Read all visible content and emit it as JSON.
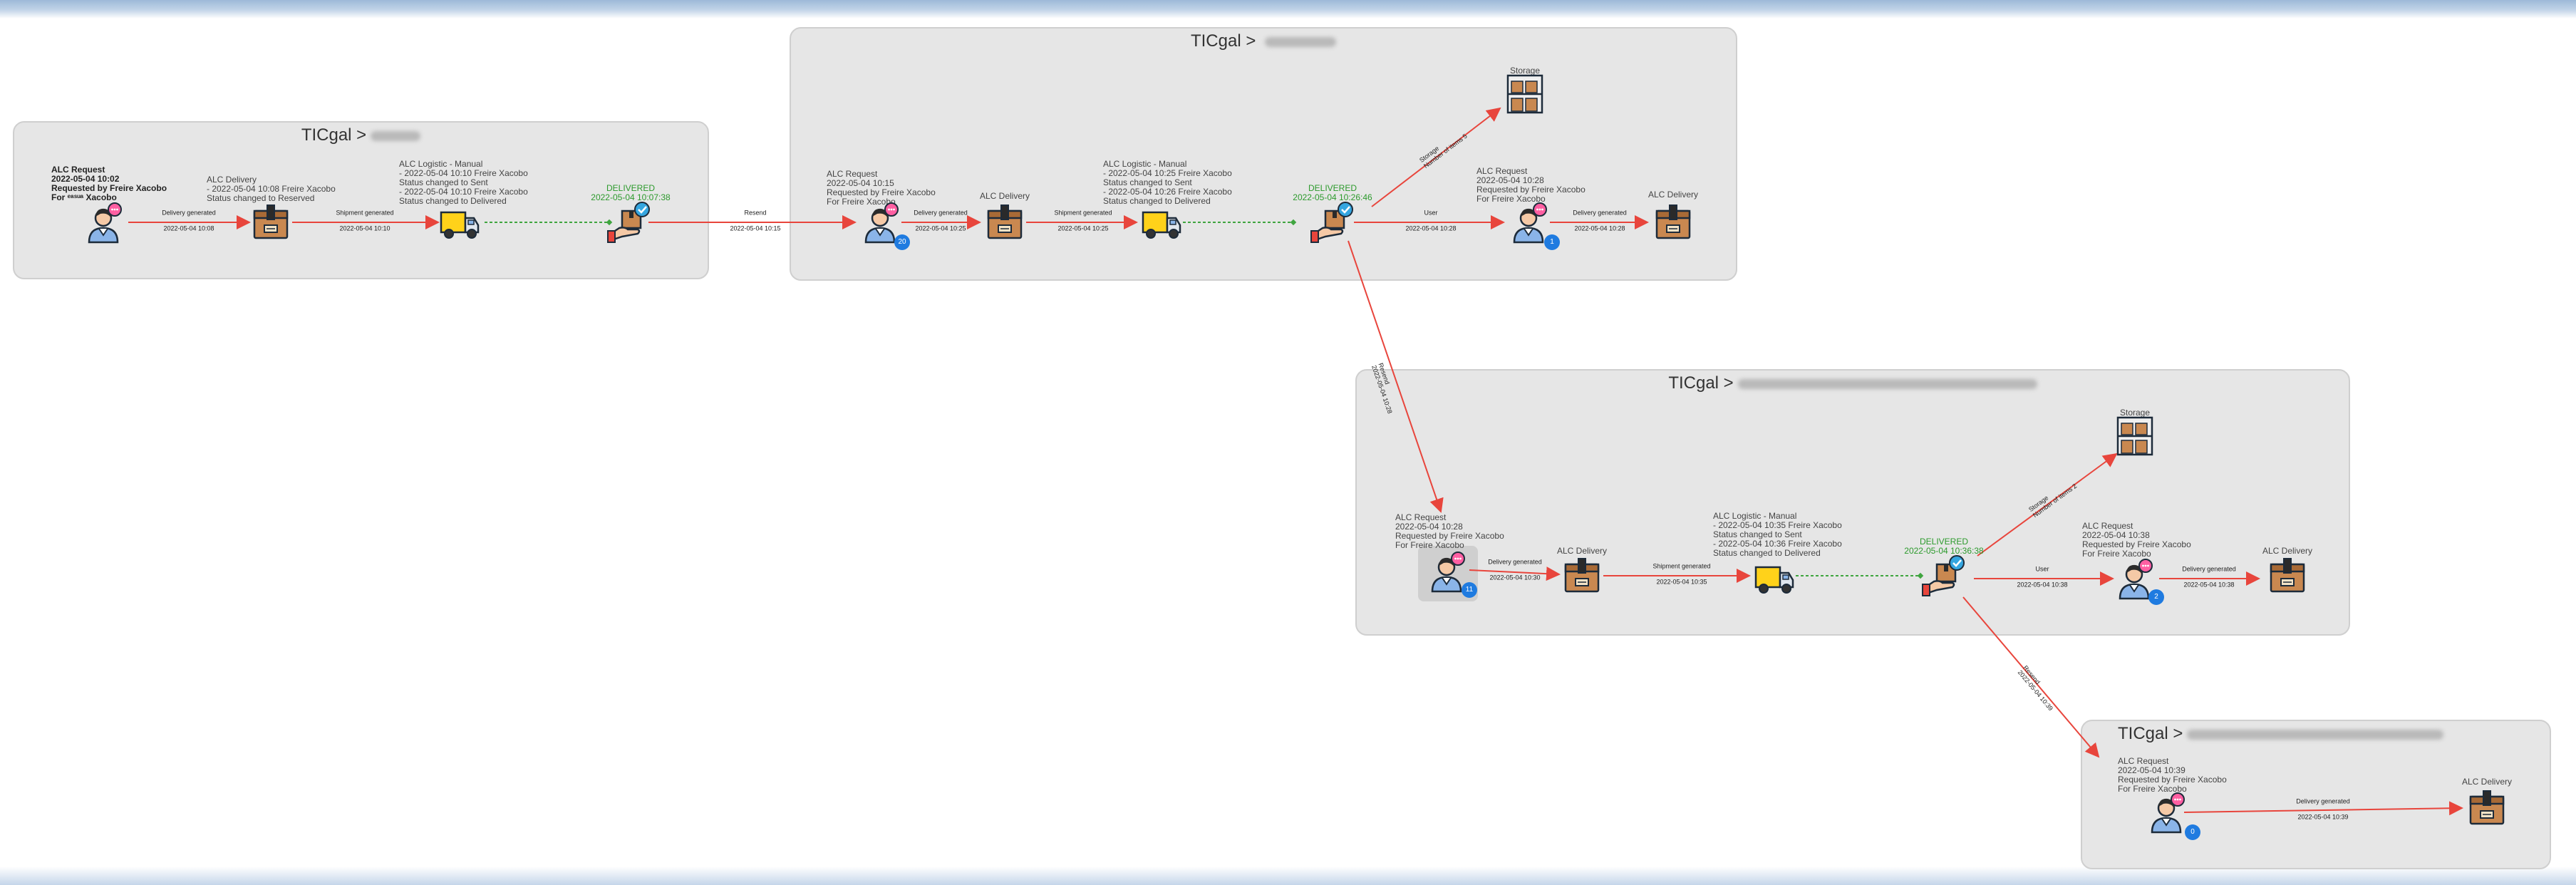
{
  "groups": [
    {
      "title": "TICgal >"
    },
    {
      "title": "TICgal > "
    },
    {
      "title": "TICgal >"
    },
    {
      "title": "TICgal >"
    }
  ],
  "g1": {
    "request_lines": "ALC Request\n2022-05-04 10:02\nRequested by Freire Xacobo\nFor ᵉᵃˢᵘᵃ Xacobo",
    "delivery_label": "ALC Delivery\n- 2022-05-04 10:08 Freire Xacobo\nStatus changed to Reserved",
    "logistic_label": "ALC Logistic - Manual\n- 2022-05-04 10:10 Freire Xacobo\nStatus changed to Sent\n- 2022-05-04 10:10 Freire Xacobo\nStatus changed to Delivered",
    "delivered": "DELIVERED\n2022-05-04 10:07:38",
    "edge1": "Delivery generated\n\n2022-05-04 10:08",
    "edge2": "Shipment generated\n\n2022-05-04 10:10"
  },
  "link_resend": "Resend\n\n2022-05-04 10:15",
  "g2": {
    "request_lines": "ALC Request\n2022-05-04 10:15\nRequested by Freire Xacobo\nFor Freire Xacobo",
    "badge": "20",
    "delivery_name": "ALC Delivery",
    "logistic_label": "ALC Logistic - Manual\n- 2022-05-04 10:25 Freire Xacobo\nStatus changed to Sent\n- 2022-05-04 10:26 Freire Xacobo\nStatus changed to Delivered",
    "delivered": "DELIVERED\n2022-05-04 10:26:46",
    "storage": "Storage",
    "storage_edge": "Storage\nNumber of items 5",
    "request2_lines": "ALC Request\n2022-05-04 10:28\nRequested by Freire Xacobo\nFor Freire Xacobo",
    "badge2": "1",
    "delivery2_name": "ALC Delivery",
    "edge1": "Delivery generated\n\n2022-05-04 10:25",
    "edge2": "Shipment generated\n\n2022-05-04 10:25",
    "edge3": "User\n\n2022-05-04 10:28",
    "edge4": "Delivery generated\n\n2022-05-04 10:28"
  },
  "link_g2_g3": "Resend\n2022-05-04 10:28",
  "g3": {
    "request_lines": "ALC Request\n2022-05-04 10:28\nRequested by Freire Xacobo\nFor Freire Xacobo",
    "badge": "11",
    "delivery_name": "ALC Delivery",
    "logistic_label": "ALC Logistic - Manual\n- 2022-05-04 10:35 Freire Xacobo\nStatus changed to Sent\n- 2022-05-04 10:36 Freire Xacobo\nStatus changed to Delivered",
    "delivered": "DELIVERED\n2022-05-04 10:36:38",
    "storage": "Storage",
    "storage_edge": "Storage\nNumber of items 2",
    "request2_lines": "ALC Request\n2022-05-04 10:38\nRequested by Freire Xacobo\nFor Freire Xacobo",
    "badge2": "2",
    "delivery2_name": "ALC Delivery",
    "edge1": "Delivery generated\n\n2022-05-04 10:30",
    "edge2": "Shipment generated\n\n2022-05-04 10:35",
    "edge3": "User\n\n2022-05-04 10:38",
    "edge4": "Delivery generated\n\n2022-05-04 10:38"
  },
  "link_g3_g4": "Resend\n2022-05-04 10:39",
  "g4": {
    "request_lines": "ALC Request\n2022-05-04 10:39\nRequested by Freire Xacobo\nFor Freire Xacobo",
    "badge": "0",
    "delivery_name": "ALC Delivery",
    "edge1": "Delivery generated\n\n2022-05-04 10:39"
  },
  "colors": {
    "edge": "#e8453c",
    "dashed": "#3fa53f",
    "delivered": "#2c9a2c",
    "badge": "#1f7be0"
  }
}
